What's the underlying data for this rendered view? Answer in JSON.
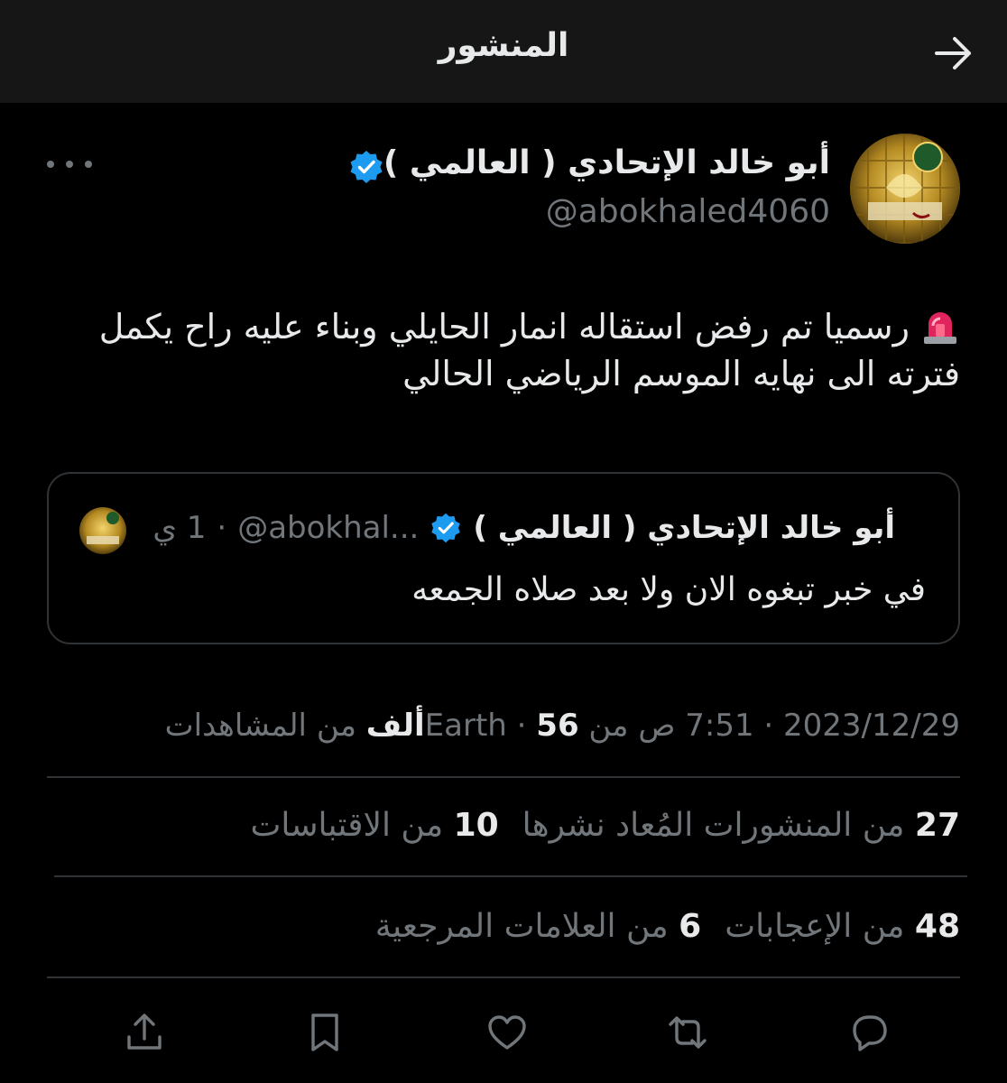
{
  "header": {
    "title": "المنشور"
  },
  "author": {
    "name": "أبو خالد الإتحادي ( العالمي )",
    "handle": "@abokhaled4060"
  },
  "post": {
    "emoji": "siren-emoji",
    "text": "رسميا تم رفض استقاله انمار الحايلي وبناء عليه راح يكمل فترته الى نهايه الموسم الرياضي الحالي"
  },
  "quote": {
    "name": "أبو خالد الإتحادي ( العالمي )",
    "handle": "@abokhal...",
    "separator": "·",
    "time": "1 ي",
    "text": "في خبر تبغوه الان ولا بعد صلاه الجمعه"
  },
  "meta": {
    "date": "2023/12/29",
    "dot1": "·",
    "time_source": "7:51 ص من Earth",
    "dot2": "·",
    "views_count": "56ألف",
    "views_label": "من المشاهدات"
  },
  "stats": {
    "reposts_count": "27",
    "reposts_label": "من المنشورات المُعاد نشرها",
    "quotes_count": "10",
    "quotes_label": "من الاقتباسات",
    "likes_count": "48",
    "likes_label": "من الإعجابات",
    "bookmarks_count": "6",
    "bookmarks_label": "من العلامات المرجعية"
  },
  "colors": {
    "background": "#000000",
    "header_bg": "#161616",
    "text_primary": "#e7e9ea",
    "text_secondary": "#71767b",
    "verified_blue": "#1d9bf0",
    "divider": "#2f3336"
  },
  "icons": {
    "back": "arrow-right-icon",
    "verified": "verified-badge-icon",
    "more": "more-horizontal-icon",
    "reply": "reply-icon",
    "repost": "repost-icon",
    "like": "heart-icon",
    "bookmark": "bookmark-icon",
    "share": "share-icon"
  }
}
